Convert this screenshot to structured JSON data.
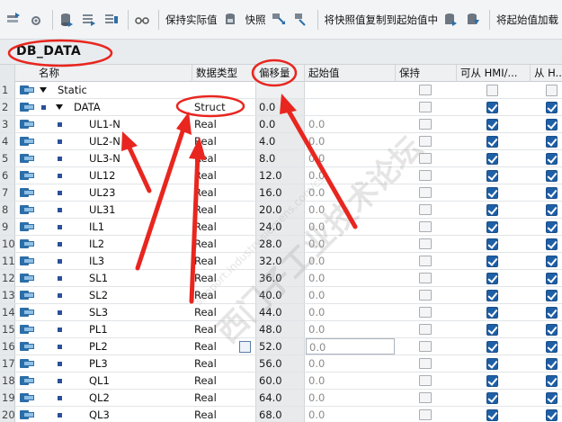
{
  "toolbar": {
    "keep_actual_label": "保持实际值",
    "snapshot_label": "快照",
    "copy_snapshot_label": "将快照值复制到起始值中",
    "load_start_label": "将起始值加载"
  },
  "block": {
    "title": "DB_DATA"
  },
  "table": {
    "headers": {
      "name": "名称",
      "type": "数据类型",
      "offset": "偏移量",
      "start": "起始值",
      "retain": "保持",
      "accessible": "可从 HMI/...",
      "writable": "从 H..."
    },
    "rows": [
      {
        "num": "1",
        "name": "Static",
        "type": "",
        "offset": "",
        "start": "",
        "level": 0,
        "expand": true,
        "checks": false
      },
      {
        "num": "2",
        "name": "DATA",
        "type": "Struct",
        "offset": "0.0",
        "start": "",
        "level": 1,
        "expand": true,
        "checks": true
      },
      {
        "num": "3",
        "name": "UL1-N",
        "type": "Real",
        "offset": "0.0",
        "start": "0.0",
        "level": 2,
        "checks": true
      },
      {
        "num": "4",
        "name": "UL2-N",
        "type": "Real",
        "offset": "4.0",
        "start": "0.0",
        "level": 2,
        "checks": true
      },
      {
        "num": "5",
        "name": "UL3-N",
        "type": "Real",
        "offset": "8.0",
        "start": "0.0",
        "level": 2,
        "checks": true
      },
      {
        "num": "6",
        "name": "UL12",
        "type": "Real",
        "offset": "12.0",
        "start": "0.0",
        "level": 2,
        "checks": true
      },
      {
        "num": "7",
        "name": "UL23",
        "type": "Real",
        "offset": "16.0",
        "start": "0.0",
        "level": 2,
        "checks": true
      },
      {
        "num": "8",
        "name": "UL31",
        "type": "Real",
        "offset": "20.0",
        "start": "0.0",
        "level": 2,
        "checks": true
      },
      {
        "num": "9",
        "name": "IL1",
        "type": "Real",
        "offset": "24.0",
        "start": "0.0",
        "level": 2,
        "checks": true
      },
      {
        "num": "10",
        "name": "IL2",
        "type": "Real",
        "offset": "28.0",
        "start": "0.0",
        "level": 2,
        "checks": true
      },
      {
        "num": "11",
        "name": "IL3",
        "type": "Real",
        "offset": "32.0",
        "start": "0.0",
        "level": 2,
        "checks": true
      },
      {
        "num": "12",
        "name": "SL1",
        "type": "Real",
        "offset": "36.0",
        "start": "0.0",
        "level": 2,
        "checks": true
      },
      {
        "num": "13",
        "name": "SL2",
        "type": "Real",
        "offset": "40.0",
        "start": "0.0",
        "level": 2,
        "checks": true
      },
      {
        "num": "14",
        "name": "SL3",
        "type": "Real",
        "offset": "44.0",
        "start": "0.0",
        "level": 2,
        "checks": true
      },
      {
        "num": "15",
        "name": "PL1",
        "type": "Real",
        "offset": "48.0",
        "start": "0.0",
        "level": 2,
        "checks": true
      },
      {
        "num": "16",
        "name": "PL2",
        "type": "Real",
        "offset": "52.0",
        "start": "0.0",
        "level": 2,
        "checks": true,
        "editing": true
      },
      {
        "num": "17",
        "name": "PL3",
        "type": "Real",
        "offset": "56.0",
        "start": "0.0",
        "level": 2,
        "checks": true
      },
      {
        "num": "18",
        "name": "QL1",
        "type": "Real",
        "offset": "60.0",
        "start": "0.0",
        "level": 2,
        "checks": true
      },
      {
        "num": "19",
        "name": "QL2",
        "type": "Real",
        "offset": "64.0",
        "start": "0.0",
        "level": 2,
        "checks": true
      },
      {
        "num": "20",
        "name": "QL3",
        "type": "Real",
        "offset": "68.0",
        "start": "0.0",
        "level": 2,
        "checks": true
      }
    ]
  },
  "watermark": {
    "text": "西门子工业技术论坛",
    "url": "support.industry.siemens.com/cs"
  },
  "colors": {
    "annotation": "#e8261f",
    "checkbox": "#1e5fa6"
  }
}
